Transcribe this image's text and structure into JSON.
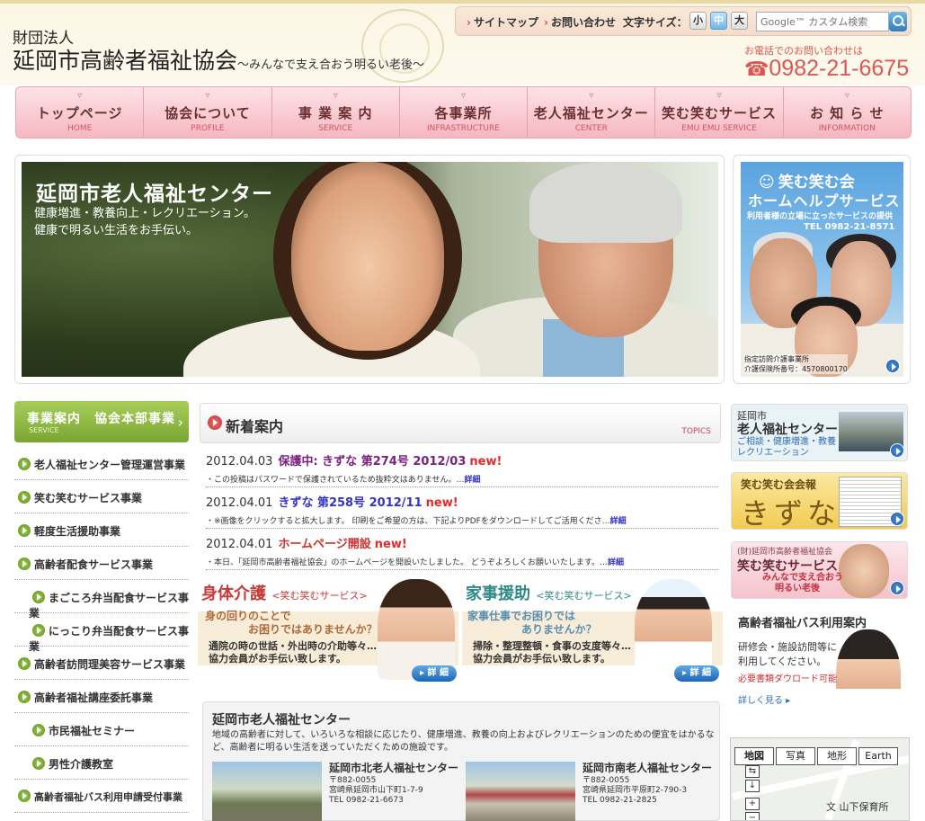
{
  "header": {
    "org_small": "財団法人",
    "org_name": "延岡市高齢者福祉協会",
    "tagline": "〜みんなで支え合おう明るい老後〜",
    "toolbar": {
      "sitemap": "サイトマップ",
      "contact": "お問い合わせ",
      "font_size_label": "文字サイズ：",
      "size_small": "小",
      "size_medium": "中",
      "size_large": "大",
      "search_placeholder": "Google™ カスタム検索"
    },
    "phone_caption": "お電話でのお問い合わせは",
    "phone_number": "0982-21-6675"
  },
  "nav": [
    {
      "jp": "トップページ",
      "en": "HOME"
    },
    {
      "jp": "協会について",
      "en": "PROFILE"
    },
    {
      "jp": "事 業 案 内",
      "en": "SERVICE"
    },
    {
      "jp": "各事業所",
      "en": "INFRASTRUCTURE"
    },
    {
      "jp": "老人福祉センター",
      "en": "CENTER"
    },
    {
      "jp": "笑む笑むサービス",
      "en": "EMU EMU SERVICE"
    },
    {
      "jp": "お 知 ら せ",
      "en": "INFORMATION"
    }
  ],
  "hero": {
    "title": "延岡市老人福祉センター",
    "line1": "健康増進・教養向上・レクリエーション。",
    "line2": "健康で明るい生活をお手伝い。"
  },
  "side_banner": {
    "title1": "笑む笑む会",
    "title2": "ホームヘルプサービス",
    "subtitle": "利用者様の立場に立ったサービスの提供",
    "tel": "TEL 0982-21-8571",
    "caption1": "指定訪問介護事業所",
    "caption2": "介護保険所番号：4570800170"
  },
  "sidebar": {
    "head_jp": "事業案内　協会本部事業",
    "head_en": "SERVICE",
    "items": [
      {
        "label": "老人福祉センター管理運営事業"
      },
      {
        "label": "笑む笑むサービス事業"
      },
      {
        "label": "軽度生活援助事業"
      },
      {
        "label": "高齢者配食サービス事業"
      },
      {
        "label": "まごころ弁当配食サービス事業"
      },
      {
        "label": "にっこり弁当配食サービス事業"
      },
      {
        "label": "高齢者訪問理美容サービス事業"
      },
      {
        "label": "高齢者福祉講座委託事業"
      },
      {
        "label": "市民福祉セミナー"
      },
      {
        "label": "男性介護教室"
      },
      {
        "label": "高齢者福祉バス利用申請受付事業"
      }
    ]
  },
  "news": {
    "title": "新着案内",
    "topics": "TOPICS",
    "items": [
      {
        "date": "2012.04.03",
        "title": "保護中: きずな 第274号 2012/03",
        "new": "new!",
        "desc": "・この投稿はパスワードで保護されているため抜粋文はありません。…",
        "more": "詳細"
      },
      {
        "date": "2012.04.01",
        "title": "きずな 第258号 2012/11",
        "new": "new!",
        "desc": "・※画像をクリックすると拡大します。 印刷をご希望の方は、下記よりPDFをダウンロードしてご活用くださ…",
        "more": "詳細"
      },
      {
        "date": "2012.04.01",
        "title": "ホームページ開設",
        "new": "new!",
        "desc": "・本日、「延岡市高齢者福祉協会」のホームページを開設いたしました。 どうぞよろしくお願いいたします。…",
        "more": "詳細"
      }
    ]
  },
  "promos": [
    {
      "title": "身体介護",
      "sub": "<笑む笑むサービス>",
      "q1": "身の回りのことで",
      "q2": "お困りではありませんか？",
      "d1": "通院の時の世話・外出時の介助等々…",
      "d2": "協力会員がお手伝い致します。",
      "button": "詳 細",
      "color": "#c53a3a"
    },
    {
      "title": "家事援助",
      "sub": "<笑む笑むサービス>",
      "q1": "家事仕事でお困りでは",
      "q2": "ありませんか？",
      "d1": "掃除・整理整頓・食事の支度等々…",
      "d2": "協力会員がお手伝い致します。",
      "button": "詳 細",
      "color": "#2f8a86"
    }
  ],
  "center_section": {
    "title": "延岡市老人福祉センター",
    "desc": "地域の高齢者に対して、いろいろな相談に応じたり、健康増進、教養の向上およびレクリエーションのための便宜をはかるなど、高齢者に明るい生活を送っていただくための施設です。",
    "branches": [
      {
        "name": "延岡市北老人福祉センター",
        "zip": "〒882-0055",
        "address": "宮崎県延岡市山下町1-7-9",
        "tel": "TEL 0982-21-6673"
      },
      {
        "name": "延岡市南老人福祉センター",
        "zip": "〒882-0055",
        "address": "宮崎県延岡市平原町2-790-3",
        "tel": "TEL 0982-21-2825"
      }
    ]
  },
  "right_col": {
    "center_banner": {
      "l1": "延岡市",
      "l2": "老人福祉センター",
      "l3a": "ご相談・健康増進・教養",
      "l3b": "レクリエーション"
    },
    "kizuna_banner": {
      "l1": "笑む笑む会会報",
      "l2": "きずな"
    },
    "emu_banner": {
      "l1": "(財)延岡市高齢者福祉協会",
      "l2": "笑む笑むサービス",
      "l3a": "みんなで支え合おう",
      "l3b": "明るい老後"
    },
    "bus": {
      "title": "高齢者福祉バス利用案内",
      "d1": "研修会・施設訪問等に",
      "d2": "利用してください。",
      "download": "必要書類ダウロード可能",
      "more": "詳しく見る"
    }
  },
  "map": {
    "tab_map": "地図",
    "tab_photo": "写真",
    "tab_terrain": "地形",
    "tab_earth": "Earth",
    "label": "文 山下保育所"
  }
}
